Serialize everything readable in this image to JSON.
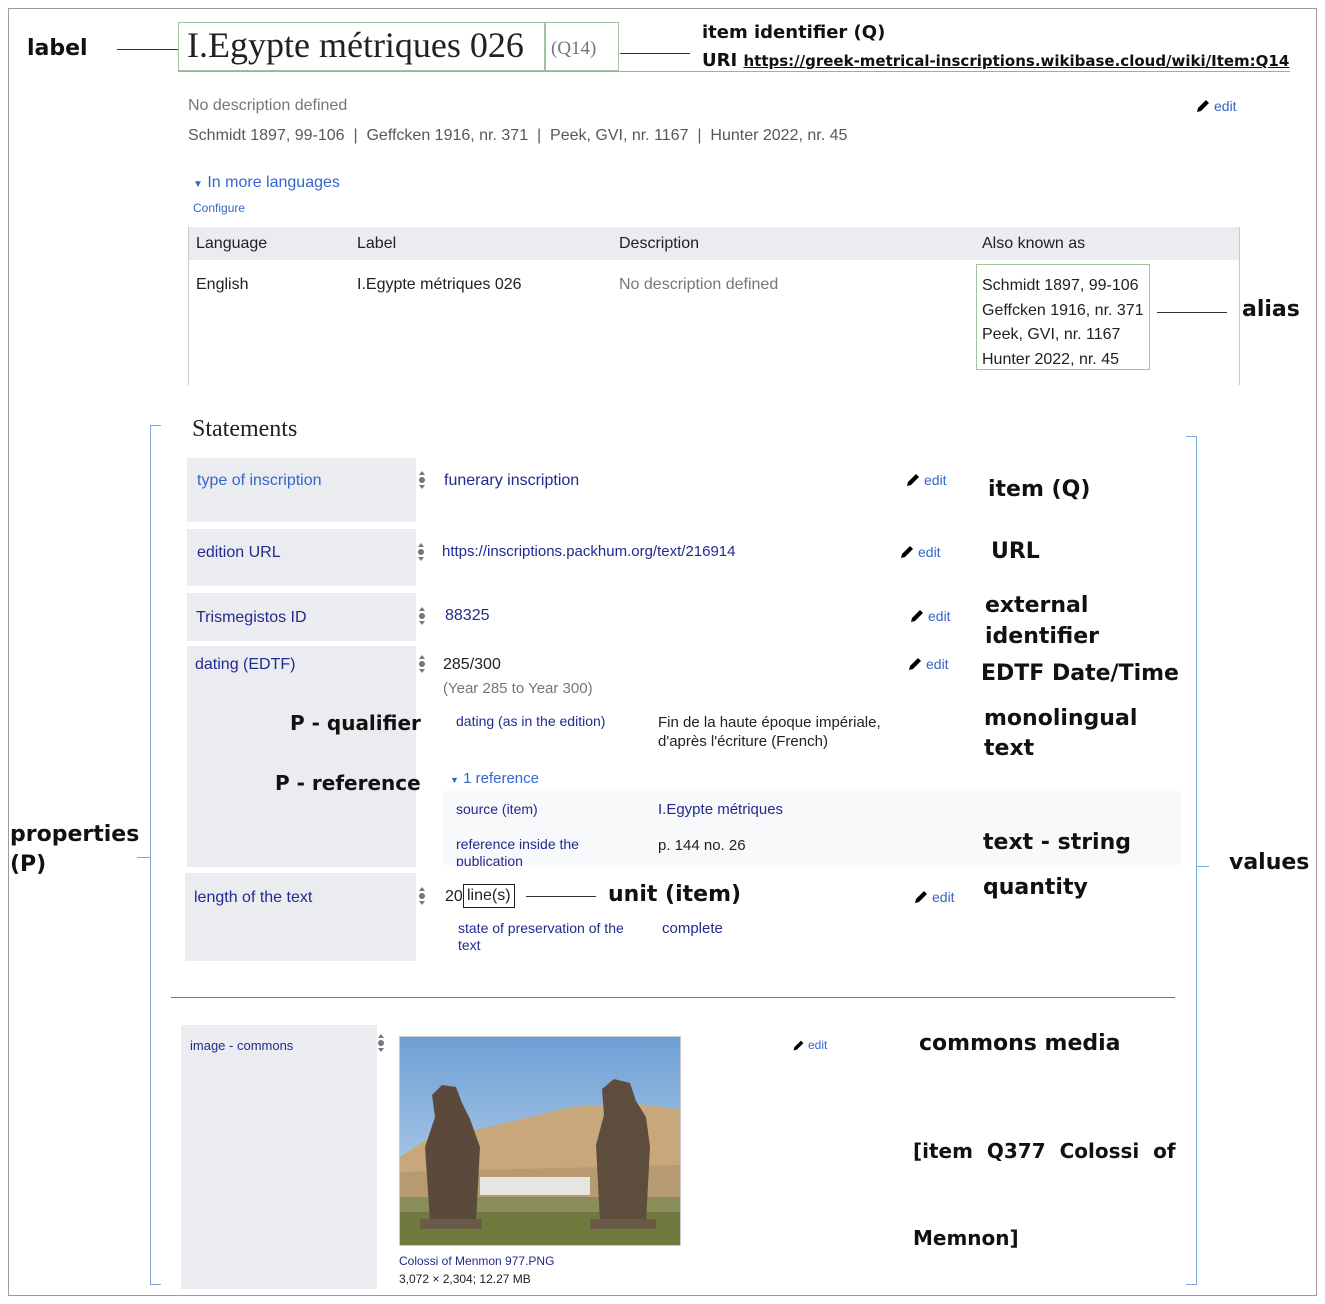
{
  "annotations": {
    "label": "label",
    "item_identifier": "item identifier (Q)",
    "uri_prefix": "URI",
    "uri": "https://greek-metrical-inscriptions.wikibase.cloud/wiki/Item:Q14",
    "alias": "alias",
    "item_q": "item (Q)",
    "url": "URL",
    "external_identifier_1": "external",
    "external_identifier_2": "identifier",
    "edtf": "EDTF Date/Time",
    "monolingual_1": "monolingual",
    "monolingual_2": "text",
    "p_qualifier": "P - qualifier",
    "p_reference": "P - reference",
    "properties_1": "properties",
    "properties_2": "(P)",
    "text_string": "text - string",
    "values": "values",
    "quantity": "quantity",
    "unit_item": "unit (item)",
    "commons_media": "commons media",
    "commons_note_1": "[item  Q377  Colossi  of",
    "commons_note_2": "Memnon]"
  },
  "header": {
    "title": "I.Egypte métriques 026",
    "qid": "(Q14)",
    "no_description": "No description defined",
    "aliases_inline": "Schmidt 1897, 99-106  |  Geffcken 1916, nr. 371  |  Peek, GVI, nr. 1167  |  Hunter 2022, nr. 45",
    "edit": "edit",
    "more_languages": "In more languages",
    "configure": "Configure"
  },
  "lang_table": {
    "headers": [
      "Language",
      "Label",
      "Description",
      "Also known as"
    ],
    "row": {
      "language": "English",
      "label": "I.Egypte métriques 026",
      "description": "No description defined",
      "aliases": [
        "Schmidt 1897, 99-106",
        "Geffcken 1916, nr. 371",
        "Peek, GVI, nr. 1167",
        "Hunter 2022, nr. 45"
      ]
    }
  },
  "statements": {
    "heading": "Statements",
    "edit": "edit",
    "type_of_inscription": {
      "property": "type of inscription",
      "value": "funerary inscription"
    },
    "edition_url": {
      "property": "edition URL",
      "value": "https://inscriptions.packhum.org/text/216914"
    },
    "trismegistos": {
      "property": "Trismegistos ID",
      "value": "88325"
    },
    "dating": {
      "property": "dating (EDTF)",
      "value": "285/300",
      "value_note": "(Year 285 to Year 300)",
      "qualifier_property": "dating (as in the edition)",
      "qualifier_value_1": "Fin de la haute époque impériale,",
      "qualifier_value_2": "d'après l'écriture (French)",
      "reference_toggle": "1 reference",
      "ref_source_property": "source (item)",
      "ref_source_value": "I.Egypte métriques",
      "ref_inside_1": "reference inside the",
      "ref_inside_2": "publication",
      "ref_inside_value": "p. 144 no. 26"
    },
    "length": {
      "property": "length of the text",
      "amount": "20",
      "unit": "line(s)",
      "qualifier_property_1": "state of preservation of the",
      "qualifier_property_2": "text",
      "qualifier_value": "complete"
    },
    "image": {
      "property": "image - commons",
      "filename": "Colossi of Menmon 977.PNG",
      "meta": "3,072 × 2,304; 12.27 MB"
    }
  },
  "colors": {
    "link": "#3366cc",
    "navy": "#202a8f",
    "property_bg": "#eaecf0",
    "bracket": "#7aa9d8"
  }
}
